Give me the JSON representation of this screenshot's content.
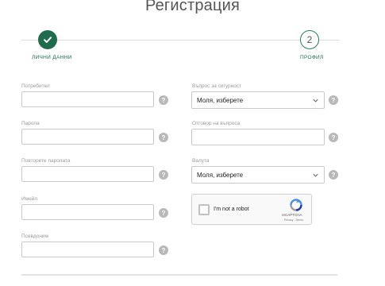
{
  "page": {
    "title": "Регистрация"
  },
  "steps": [
    {
      "label": "ЛИЧНИ ДАННИ",
      "state": "completed",
      "icon": "check-icon"
    },
    {
      "label": "ПРОФИЛ",
      "number": "2",
      "state": "upcoming"
    }
  ],
  "left_fields": [
    {
      "label": "Потребител",
      "value": ""
    },
    {
      "label": "Парола",
      "value": ""
    },
    {
      "label": "Повторете паролата",
      "value": ""
    },
    {
      "label": "Имейл",
      "value": ""
    },
    {
      "label": "Псевдоним",
      "value": ""
    }
  ],
  "right_fields": {
    "security_question": {
      "label": "Въпрос за сигурност",
      "selected": "Моля, изберете"
    },
    "security_answer": {
      "label": "Отговор на въпроса",
      "value": ""
    },
    "currency": {
      "label": "Валута",
      "selected": "Моля, изберете"
    }
  },
  "help": {
    "symbol": "?"
  },
  "captcha": {
    "label": "I'm not a robot",
    "brand": "reCAPTCHA",
    "links": "Privacy - Terms"
  },
  "colors": {
    "accent": "#1f6b4d",
    "help_bg": "#b8b8b8",
    "border": "#c9c9c9"
  }
}
